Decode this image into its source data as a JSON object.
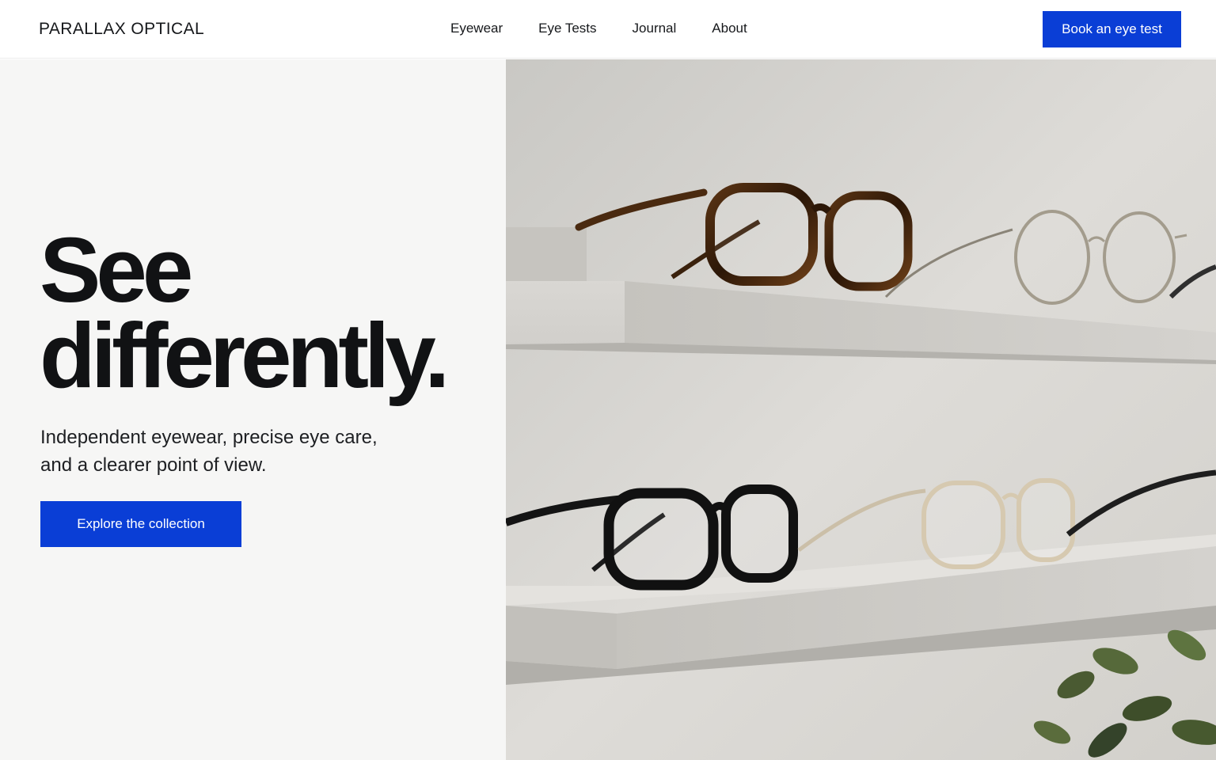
{
  "header": {
    "brand": "PARALLAX OPTICAL",
    "nav": [
      {
        "label": "Eyewear"
      },
      {
        "label": "Eye Tests"
      },
      {
        "label": "Journal"
      },
      {
        "label": "About"
      }
    ],
    "cta_label": "Book an eye test"
  },
  "hero": {
    "headline_line1": "See",
    "headline_line2": "differently.",
    "subcopy_line1": "Independent eyewear, precise eye care,",
    "subcopy_line2": "and a clearer point of view.",
    "cta_label": "Explore the collection"
  },
  "colors": {
    "accent": "#0a3ed6",
    "text": "#111214",
    "panel": "#f6f6f5"
  }
}
